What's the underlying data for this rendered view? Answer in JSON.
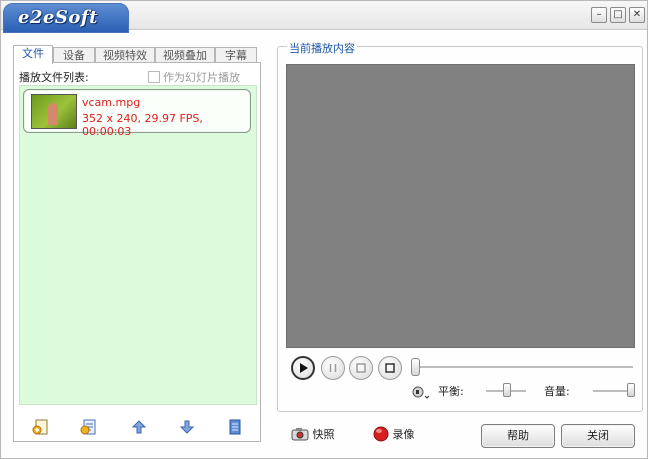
{
  "app": {
    "logo": "e2eSoft"
  },
  "window_controls": {
    "minimize": "–",
    "maximize": "□",
    "close": "✕"
  },
  "tabs": [
    {
      "label": "文件",
      "active": true
    },
    {
      "label": "设备",
      "active": false
    },
    {
      "label": "视频特效",
      "active": false
    },
    {
      "label": "视频叠加",
      "active": false
    },
    {
      "label": "字幕",
      "active": false
    }
  ],
  "file_panel": {
    "list_label": "播放文件列表:",
    "slideshow_label": "作为幻灯片播放",
    "slideshow_checked": false,
    "files": [
      {
        "name": "vcam.mpg",
        "info": "352 x 240, 29.97 FPS, 00:00:03"
      }
    ],
    "toolbar_icons": [
      "add-file-icon",
      "add-folder-icon",
      "move-up-icon",
      "move-down-icon",
      "delete-icon"
    ]
  },
  "preview": {
    "title": "当前播放内容",
    "balance_label": "平衡:",
    "volume_label": "音量:",
    "seek_position": 0,
    "balance": 0.5,
    "volume": 1.0
  },
  "bottom": {
    "snapshot_label": "快照",
    "record_label": "录像",
    "help_label": "帮助",
    "close_label": "关闭"
  },
  "colors": {
    "accent": "#1d56a8",
    "file_text": "#e02020",
    "list_bg": "#dcfbdc",
    "video_bg": "#818181"
  }
}
